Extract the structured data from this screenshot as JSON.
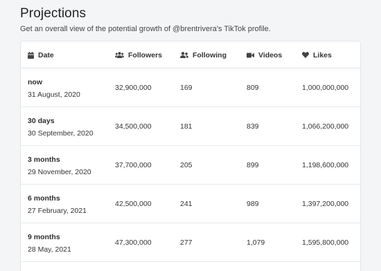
{
  "page": {
    "title": "Projections",
    "subtitle": "Get an overall view of the potential growth of @brentrivera's TikTok profile."
  },
  "table": {
    "headers": {
      "date": {
        "label": "Date",
        "icon": "calendar-icon"
      },
      "followers": {
        "label": "Followers",
        "icon": "users-icon"
      },
      "following": {
        "label": "Following",
        "icon": "user-friends-icon"
      },
      "videos": {
        "label": "Videos",
        "icon": "video-camera-icon"
      },
      "likes": {
        "label": "Likes",
        "icon": "heart-icon"
      }
    },
    "rows": [
      {
        "period": "now",
        "date": "31 August, 2020",
        "followers": "32,900,000",
        "following": "169",
        "videos": "809",
        "likes": "1,000,000,000"
      },
      {
        "period": "30 days",
        "date": "30 September, 2020",
        "followers": "34,500,000",
        "following": "181",
        "videos": "839",
        "likes": "1,066,200,000"
      },
      {
        "period": "3 months",
        "date": "29 November, 2020",
        "followers": "37,700,000",
        "following": "205",
        "videos": "899",
        "likes": "1,198,600,000"
      },
      {
        "period": "6 months",
        "date": "27 February, 2021",
        "followers": "42,500,000",
        "following": "241",
        "videos": "989",
        "likes": "1,397,200,000"
      },
      {
        "period": "9 months",
        "date": "28 May, 2021",
        "followers": "47,300,000",
        "following": "277",
        "videos": "1,079",
        "likes": "1,595,800,000"
      }
    ]
  }
}
